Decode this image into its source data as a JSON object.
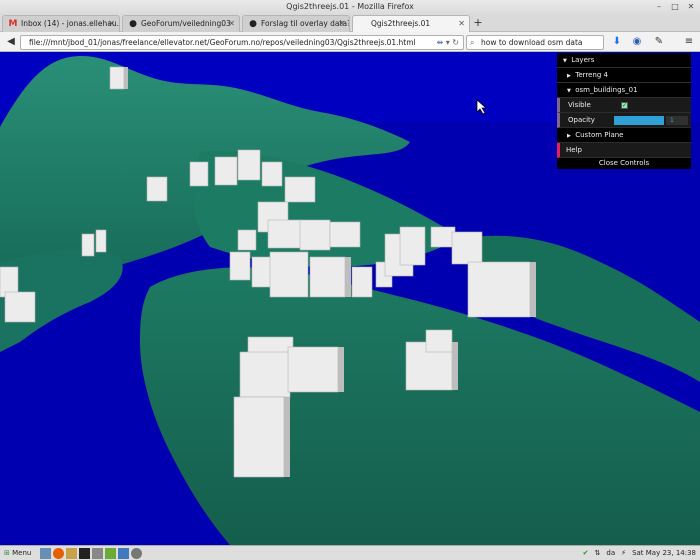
{
  "window": {
    "title": "Qgis2threejs.01 - Mozilla Firefox"
  },
  "tabs": [
    {
      "label": "Inbox (14) - jonas.ellehau...",
      "icon": "gmail-icon",
      "icon_glyph": "M",
      "icon_color": "#d93025"
    },
    {
      "label": "GeoForum/veiledning03",
      "icon": "github-icon",
      "icon_glyph": "●",
      "icon_color": "#222222"
    },
    {
      "label": "Forslag til overlay data? · ...",
      "icon": "github-icon",
      "icon_glyph": "●",
      "icon_color": "#222222"
    },
    {
      "label": "Qgis2threejs.01",
      "icon": "page-icon",
      "icon_glyph": "",
      "icon_color": "#888888"
    }
  ],
  "nav": {
    "url": "file:///mnt/jbod_01/jonas/freelance/ellevator.net/GeoForum.no/repos/veiledning03/Qgis2threejs.01.html",
    "search_value": "how to download osm data"
  },
  "gui": {
    "layers_label": "Layers",
    "terrain_label": "Terreng 4",
    "buildings_label": "osm_buildings_01",
    "visible_label": "Visible",
    "visible_checked": true,
    "opacity_label": "Opacity",
    "opacity_value": "1",
    "opacity_fraction": 1,
    "custom_plane_label": "Custom Plane",
    "help_label": "Help",
    "close_label": "Close Controls"
  },
  "taskbar": {
    "menu_label": "Menu",
    "keyboard_layout": "da",
    "clock": "Sat May 23, 14:38"
  },
  "colors": {
    "sea": "#0000b0",
    "terrain": "#1c7b64",
    "building": "#e8e8e8",
    "slider_accent": "#2fa1d6"
  }
}
